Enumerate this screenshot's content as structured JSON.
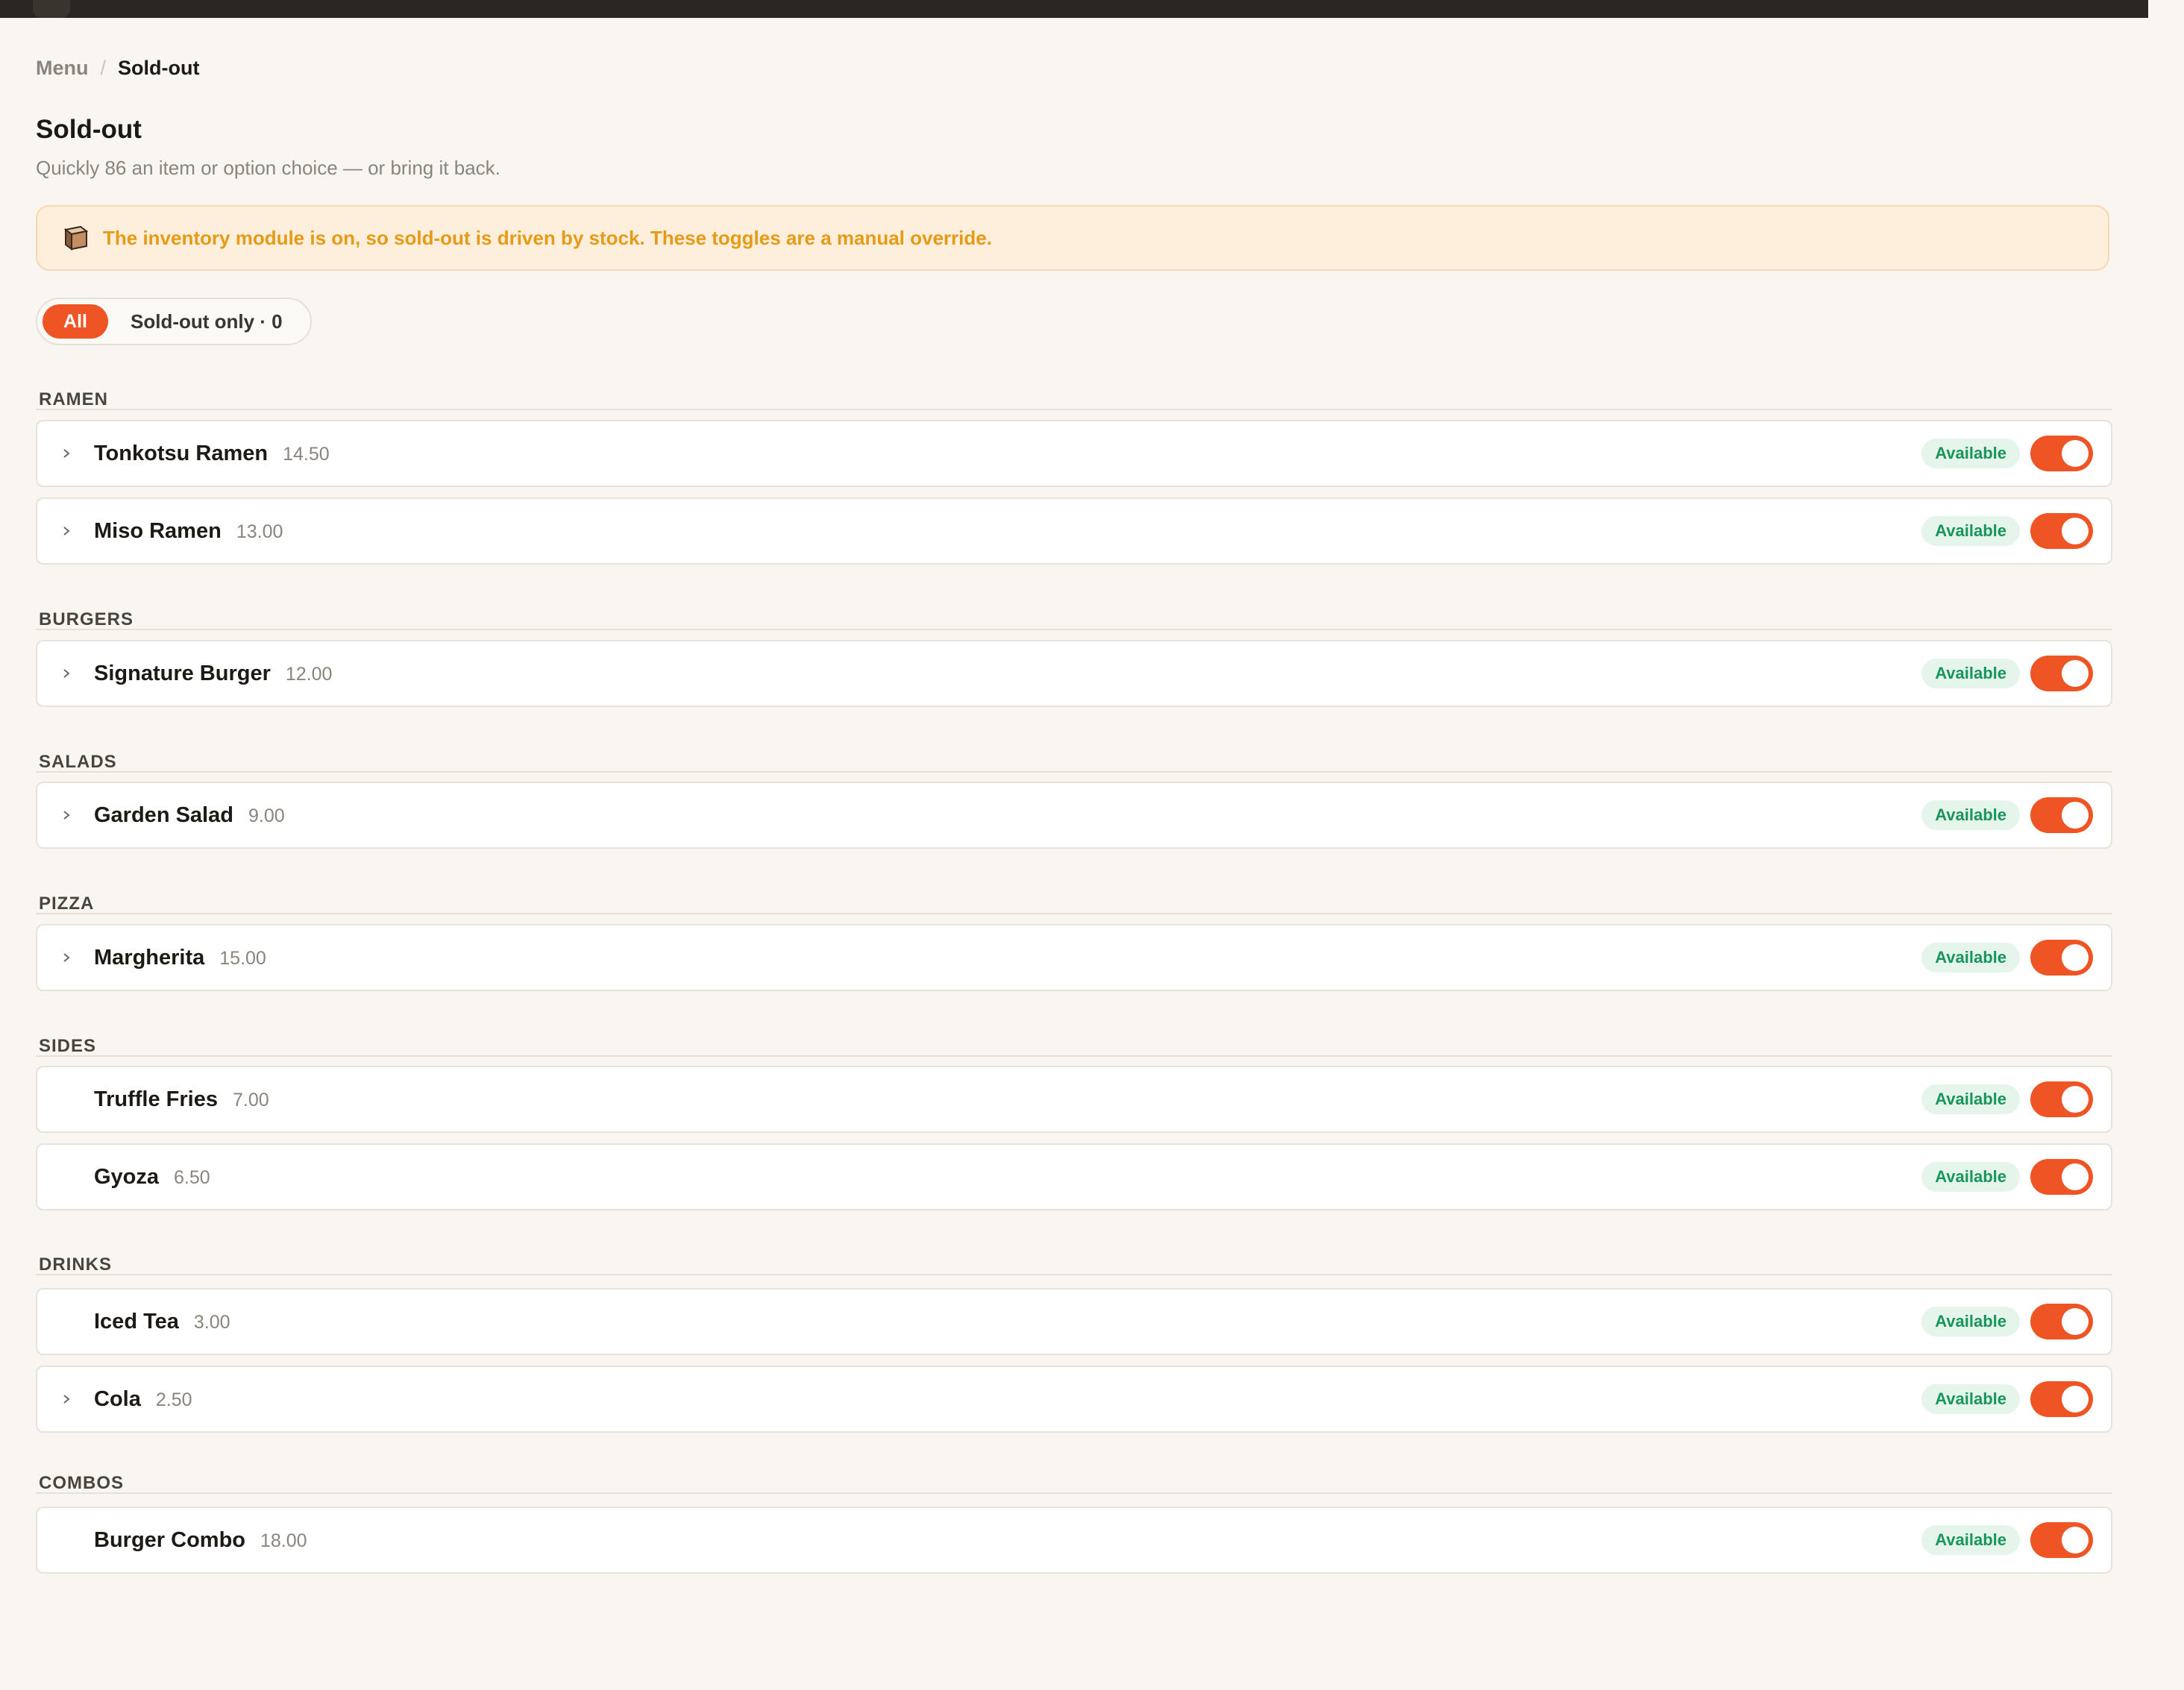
{
  "breadcrumb": {
    "root": "Menu",
    "current": "Sold-out"
  },
  "page": {
    "title": "Sold-out",
    "subtitle": "Quickly 86 an item or option choice — or bring it back."
  },
  "notice": {
    "icon": "box-icon",
    "text": "The inventory module is on, so sold-out is driven by stock. These toggles are a manual override."
  },
  "filter": {
    "all_label": "All",
    "soldout_label": "Sold-out only · 0"
  },
  "colors": {
    "accent": "#ee5424",
    "available_text": "#17955a",
    "available_bg": "#e6f5ec",
    "notice_text": "#e69a16"
  },
  "sections": [
    {
      "label": "RAMEN",
      "items": [
        {
          "name": "Tonkotsu Ramen",
          "price": "14.50",
          "status": "Available",
          "expandable": true,
          "enabled": true
        },
        {
          "name": "Miso Ramen",
          "price": "13.00",
          "status": "Available",
          "expandable": true,
          "enabled": true
        }
      ]
    },
    {
      "label": "BURGERS",
      "items": [
        {
          "name": "Signature Burger",
          "price": "12.00",
          "status": "Available",
          "expandable": true,
          "enabled": true
        }
      ]
    },
    {
      "label": "SALADS",
      "items": [
        {
          "name": "Garden Salad",
          "price": "9.00",
          "status": "Available",
          "expandable": true,
          "enabled": true
        }
      ]
    },
    {
      "label": "PIZZA",
      "items": [
        {
          "name": "Margherita",
          "price": "15.00",
          "status": "Available",
          "expandable": true,
          "enabled": true
        }
      ]
    },
    {
      "label": "SIDES",
      "items": [
        {
          "name": "Truffle Fries",
          "price": "7.00",
          "status": "Available",
          "expandable": false,
          "enabled": true
        },
        {
          "name": "Gyoza",
          "price": "6.50",
          "status": "Available",
          "expandable": false,
          "enabled": true
        }
      ]
    },
    {
      "label": "DRINKS",
      "items": [
        {
          "name": "Iced Tea",
          "price": "3.00",
          "status": "Available",
          "expandable": false,
          "enabled": true
        },
        {
          "name": "Cola",
          "price": "2.50",
          "status": "Available",
          "expandable": true,
          "enabled": true
        }
      ]
    },
    {
      "label": "COMBOS",
      "items": [
        {
          "name": "Burger Combo",
          "price": "18.00",
          "status": "Available",
          "expandable": false,
          "enabled": true
        }
      ]
    }
  ]
}
